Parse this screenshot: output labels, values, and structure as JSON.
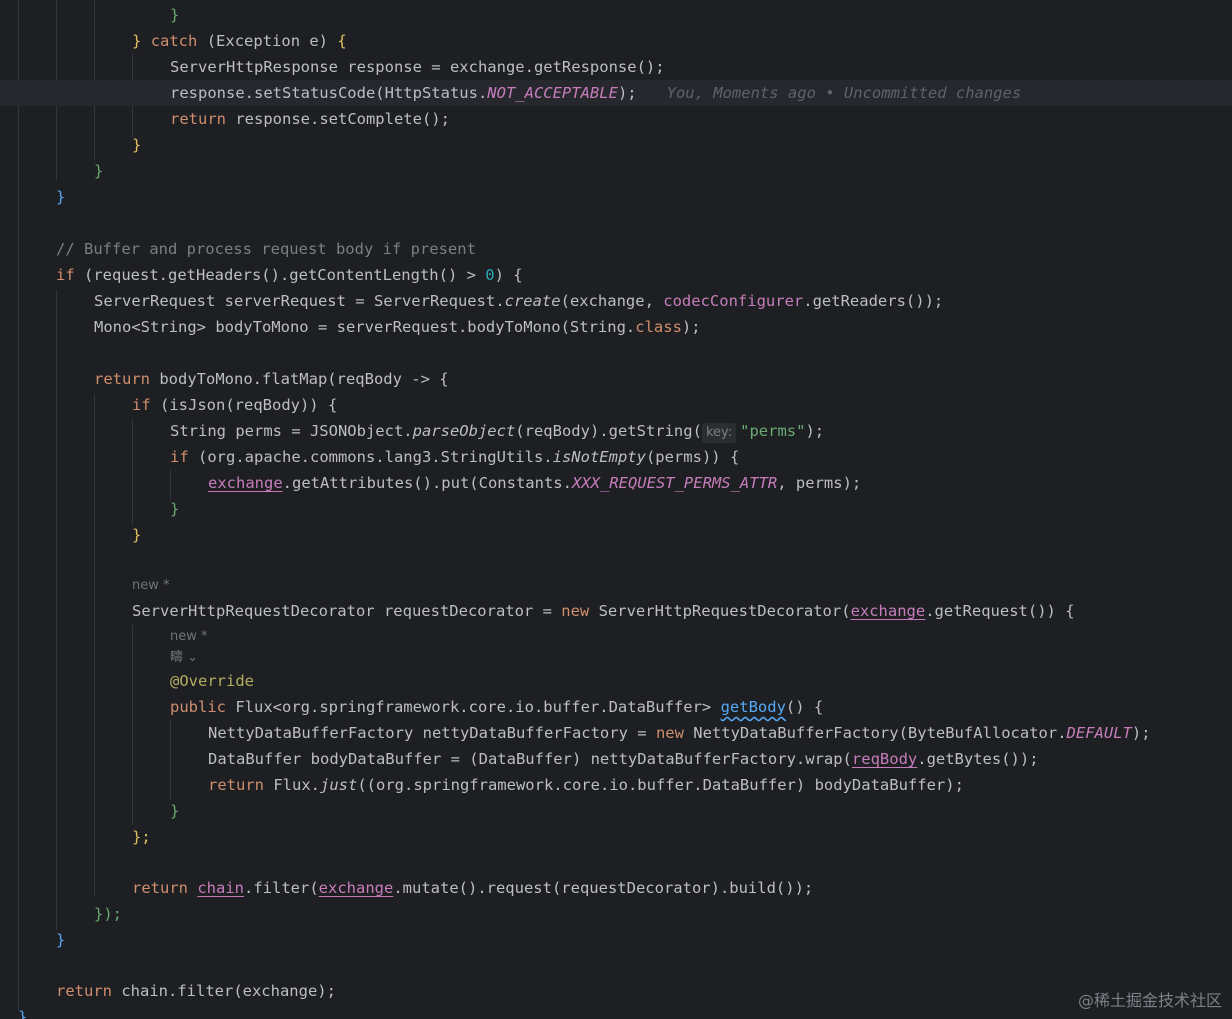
{
  "editor": {
    "blame": "You, Moments ago • Uncommitted changes",
    "lens_new": "new *",
    "gutter_icon": "疇 ⌄",
    "inlay_key": "key:"
  },
  "tokens": {
    "catch": "catch",
    "exception": "(Exception e)",
    "server_http_response": "ServerHttpResponse response = exchange.getResponse();",
    "set_status_prefix": "response.setStatusCode(HttpStatus.",
    "not_acceptable": "NOT_ACCEPTABLE",
    "set_status_suffix": ");",
    "return_kw": "return",
    "set_complete": " response.setComplete();",
    "comment": "// Buffer and process request body if present",
    "if_kw": "if",
    "if_cond": " (request.getHeaders().getContentLength() > ",
    "zero": "0",
    "if_tail": ") {",
    "server_request_a": "ServerRequest serverRequest = ServerRequest.",
    "create": "create",
    "server_request_b": "(exchange, ",
    "codec_configurer": "codecConfigurer",
    "server_request_c": ".getReaders());",
    "mono_line": "Mono<String> bodyToMono = serverRequest.bodyToMono(String.",
    "class_kw": "class",
    "mono_tail": ");",
    "flatmap": " bodyToMono.flatMap(reqBody -> {",
    "isjson": " (isJson(reqBody)) {",
    "string_perms_a": "String perms = JSONObject.",
    "parse_object": "parseObject",
    "string_perms_b": "(reqBody).getString(",
    "perms_str": "\"perms\"",
    "string_perms_c": ");",
    "if_notempty_a": " (org.apache.commons.lang3.StringUtils.",
    "is_not_empty": "isNotEmpty",
    "if_notempty_b": "(perms)) {",
    "exchange": "exchange",
    "put_a": ".getAttributes().put(Constants.",
    "perms_attr": "XXX_REQUEST_PERMS_ATTR",
    "put_b": ", perms);",
    "decorator_a": "ServerHttpRequestDecorator requestDecorator = ",
    "new_kw": "new",
    "decorator_b": " ServerHttpRequestDecorator(",
    "decorator_c": ".getRequest()) {",
    "override": "@Override",
    "public_kw": "public",
    "flux_sig": " Flux<org.springframework.core.io.buffer.DataBuffer> ",
    "get_body": "getBody",
    "sig_tail": "() {",
    "netty_a": "NettyDataBufferFactory nettyDataBufferFactory = ",
    "netty_b": " NettyDataBufferFactory(ByteBufAllocator.",
    "default_const": "DEFAULT",
    "netty_c": ");",
    "databuffer_a": "DataBuffer bodyDataBuffer = (DataBuffer) nettyDataBufferFactory.wrap(",
    "req_body": "reqBody",
    "databuffer_b": ".getBytes());",
    "flux_a": " Flux.",
    "just": "just",
    "flux_b": "((org.springframework.core.io.buffer.DataBuffer) bodyDataBuffer);",
    "chain": "chain",
    "filter_a": ".filter(",
    "filter_b": ".mutate().request(requestDecorator).build());",
    "close_lambda": "});",
    "close_anon": "};",
    "final_return": " chain.filter(exchange);",
    "brace_open": "{",
    "brace_close": "}"
  },
  "watermark": "@稀土掘金技术社区"
}
